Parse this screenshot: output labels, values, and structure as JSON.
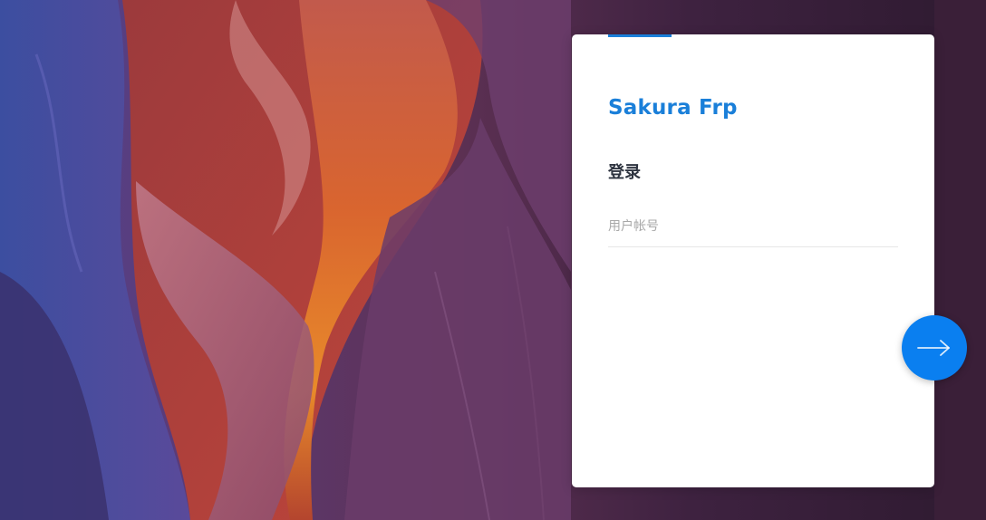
{
  "brand": {
    "name": "Sakura Frp",
    "color": "#1a7fd9"
  },
  "login": {
    "heading": "登录",
    "username_placeholder": "用户帐号",
    "username_value": ""
  },
  "next_button": {
    "icon": "arrow-right-icon",
    "color": "#0a7ff0"
  },
  "background": {
    "image": "antelope-canyon-photo"
  }
}
